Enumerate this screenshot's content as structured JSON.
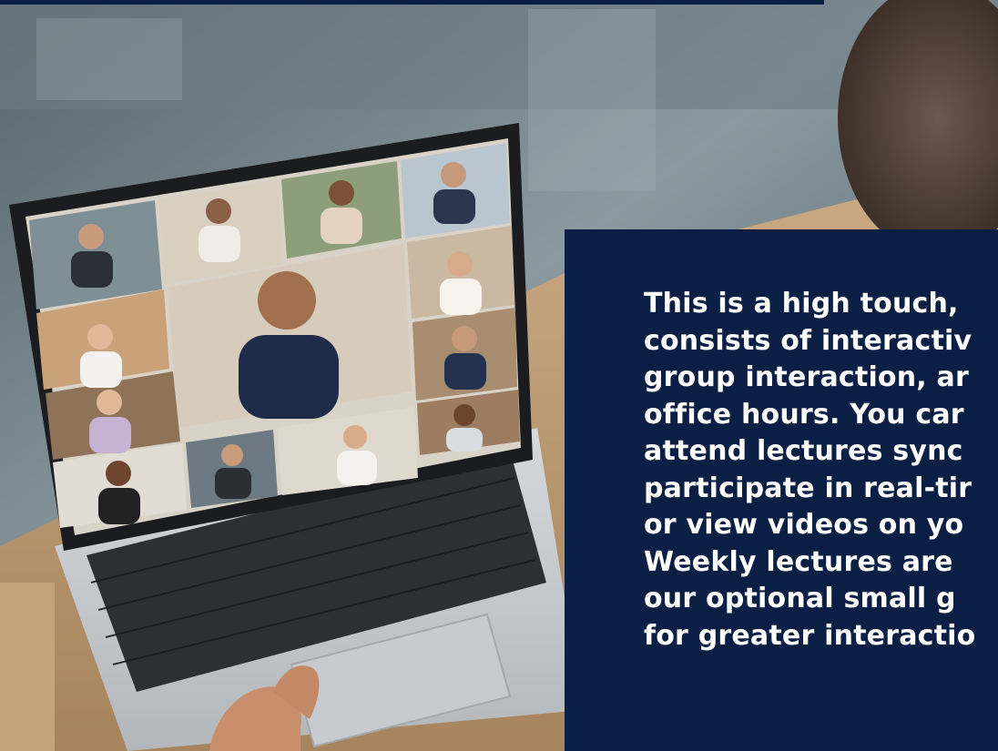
{
  "hero": {
    "description": "This is a high touch, \nconsists of interactiv\ngroup interaction, ar\noffice hours. You car\nattend lectures sync\nparticipate in real-tir\nor view videos on yo\nWeekly lectures are \nour optional small g\nfor greater interactio"
  },
  "colors": {
    "panel_background": "#0b1f45",
    "panel_text": "#ffffff"
  },
  "icons": {
    "photo": "laptop-video-call-photo"
  }
}
